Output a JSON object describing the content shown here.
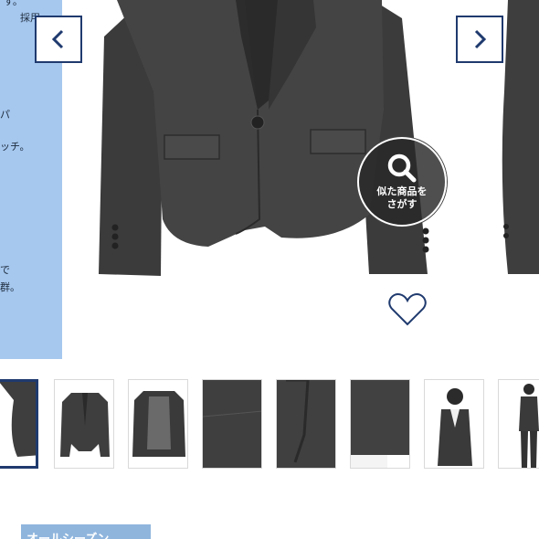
{
  "description": {
    "lines": [
      "す。",
      "採用。",
      "パ",
      "ッチ。",
      "で",
      "群。"
    ]
  },
  "gallery": {
    "prev_label": "‹",
    "next_label": "›",
    "similar_search": {
      "line1": "似た商品を",
      "line2": "さがす"
    }
  },
  "thumbnails": [
    {
      "type": "jacket-partial"
    },
    {
      "type": "jacket-front"
    },
    {
      "type": "jacket-back-lining"
    },
    {
      "type": "fabric-closeup"
    },
    {
      "type": "lapel-closeup"
    },
    {
      "type": "sleeve-closeup"
    },
    {
      "type": "model-front"
    },
    {
      "type": "model-full"
    }
  ],
  "season_tag": "オールシーズン",
  "colors": {
    "accent": "#1f3a6e",
    "panel": "#a6c8ef",
    "tag": "#8fb5dd",
    "jacket": "#3e3e3e"
  }
}
